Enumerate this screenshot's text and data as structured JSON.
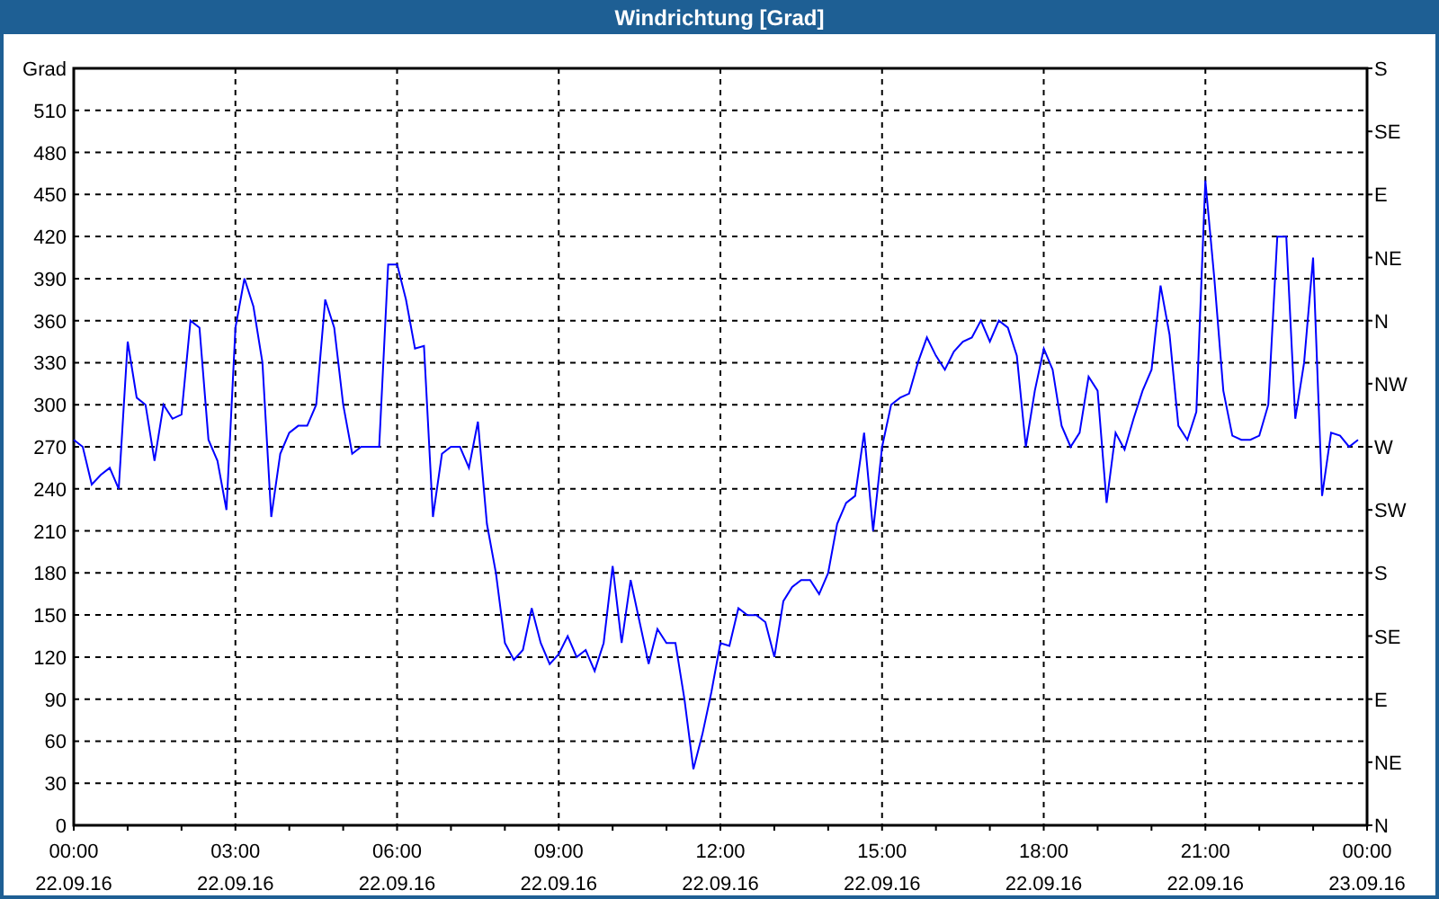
{
  "window": {
    "title": "Windrichtung [Grad]"
  },
  "chart": {
    "chart_data": {
      "type": "line",
      "grid": true,
      "ylabel": "Grad",
      "ylim": [
        0,
        540
      ],
      "yticks": [
        0,
        30,
        60,
        90,
        120,
        150,
        180,
        210,
        240,
        270,
        300,
        330,
        360,
        390,
        420,
        450,
        480,
        510
      ],
      "categories": [
        "00:00 22.09.16",
        null,
        null,
        null,
        null,
        null,
        null,
        null,
        null,
        null,
        null,
        null,
        null,
        null,
        null,
        null,
        null,
        null,
        "03:00 22.09.16",
        null,
        null,
        null,
        null,
        null,
        null,
        null,
        null,
        null,
        null,
        null,
        null,
        null,
        null,
        null,
        null,
        null,
        "06:00 22.09.16",
        null,
        null,
        null,
        null,
        null,
        null,
        null,
        null,
        null,
        null,
        null,
        null,
        null,
        null,
        null,
        null,
        null,
        "09:00 22.09.16",
        null,
        null,
        null,
        null,
        null,
        null,
        null,
        null,
        null,
        null,
        null,
        null,
        null,
        null,
        null,
        null,
        null,
        "12:00 22.09.16",
        null,
        null,
        null,
        null,
        null,
        null,
        null,
        null,
        null,
        null,
        null,
        null,
        null,
        null,
        null,
        null,
        null,
        "15:00 22.09.16",
        null,
        null,
        null,
        null,
        null,
        null,
        null,
        null,
        null,
        null,
        null,
        null,
        null,
        null,
        null,
        null,
        null,
        "18:00 22.09.16",
        null,
        null,
        null,
        null,
        null,
        null,
        null,
        null,
        null,
        null,
        null,
        null,
        null,
        null,
        null,
        null,
        null,
        "21:00 22.09.16",
        null,
        null,
        null,
        null,
        null,
        null,
        null,
        null,
        null,
        null,
        null,
        null,
        null,
        null,
        null,
        null,
        null,
        "00:00 23.09.16"
      ],
      "series": [
        {
          "color": "#0000ff",
          "values": [
            275,
            270,
            243,
            250,
            255,
            240,
            345,
            305,
            300,
            260,
            300,
            290,
            293,
            360,
            355,
            275,
            260,
            225,
            355,
            390,
            370,
            330,
            220,
            265,
            280,
            285,
            285,
            300,
            375,
            355,
            300,
            265,
            270,
            270,
            270,
            400,
            400,
            375,
            340,
            342,
            220,
            265,
            270,
            270,
            255,
            288,
            215,
            180,
            130,
            118,
            125,
            155,
            130,
            115,
            122,
            135,
            120,
            125,
            110,
            130,
            185,
            130,
            175,
            145,
            115,
            140,
            130,
            130,
            90,
            40,
            65,
            95,
            130,
            128,
            155,
            150,
            150,
            145,
            120,
            160,
            170,
            175,
            175,
            165,
            180,
            215,
            230,
            235,
            280,
            210,
            270,
            300,
            305,
            308,
            330,
            348,
            335,
            325,
            338,
            345,
            348,
            360,
            345,
            360,
            355,
            335,
            270,
            310,
            340,
            325,
            285,
            270,
            280,
            320,
            310,
            230,
            280,
            268,
            290,
            310,
            325,
            385,
            350,
            285,
            275,
            295,
            460,
            390,
            310,
            278,
            275,
            275,
            278,
            300,
            420,
            420,
            290,
            330,
            405,
            235,
            280,
            278,
            270,
            275,
            null
          ]
        }
      ]
    },
    "compass_axis": [
      "S",
      "SE",
      "E",
      "NE",
      "N",
      "NW",
      "W",
      "SW",
      "S",
      "SE",
      "E",
      "NE",
      "N"
    ]
  }
}
